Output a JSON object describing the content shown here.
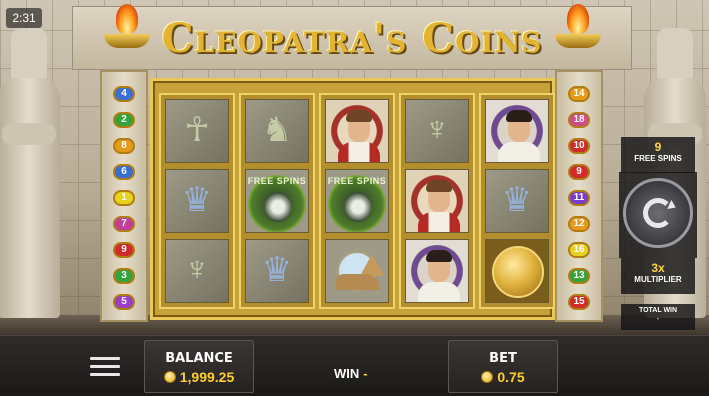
{
  "status": {
    "time": "2:31"
  },
  "game": {
    "title": "Cleopatra's Coins"
  },
  "paylines": {
    "left": [
      "4",
      "2",
      "8",
      "6",
      "1",
      "7",
      "9",
      "3",
      "5"
    ],
    "right": [
      "14",
      "18",
      "10",
      "9",
      "11",
      "12",
      "16",
      "13",
      "15"
    ],
    "left_colors": [
      "#3a6fd1",
      "#34a33c",
      "#e59a1c",
      "#3a6fd1",
      "#e7d21e",
      "#c23d9a",
      "#d02a2a",
      "#34a33c",
      "#9a3ec6"
    ],
    "right_colors": [
      "#e59a1c",
      "#d04a8a",
      "#d02a2a",
      "#d02a2a",
      "#7a3ec6",
      "#e59a1c",
      "#e7d21e",
      "#34a33c",
      "#d02a2a"
    ]
  },
  "reels": [
    [
      {
        "symbol": "ankh-figure"
      },
      {
        "symbol": "seated-pharaoh",
        "tint": "blue"
      },
      {
        "symbol": "goddess-figure"
      }
    ],
    [
      {
        "symbol": "jackal-figure"
      },
      {
        "symbol": "free-spins"
      },
      {
        "symbol": "seated-pharaoh",
        "tint": "blue"
      }
    ],
    [
      {
        "symbol": "roman-man",
        "frame": "red"
      },
      {
        "symbol": "free-spins"
      },
      {
        "symbol": "sphinx"
      }
    ],
    [
      {
        "symbol": "goddess-figure"
      },
      {
        "symbol": "roman-man",
        "frame": "red"
      },
      {
        "symbol": "roman-emperor",
        "frame": "purple"
      }
    ],
    [
      {
        "symbol": "roman-emperor",
        "frame": "purple"
      },
      {
        "symbol": "seated-pharaoh",
        "tint": "blue"
      },
      {
        "symbol": "gold-coin"
      }
    ]
  ],
  "free_spin_symbol": {
    "label": "FREE SPINS"
  },
  "side": {
    "free_spins_count": "9",
    "free_spins_label": "FREE SPINS",
    "multiplier_value": "3x",
    "multiplier_label": "MULTIPLIER",
    "total_win_label": "TOTAL WIN",
    "total_win_value": "-"
  },
  "bottom": {
    "balance_label": "BALANCE",
    "balance_value": "1,999.25",
    "win_label": "WIN",
    "win_value": "-",
    "bet_label": "BET",
    "bet_value": "0.75"
  },
  "colors": {
    "accent_gold": "#ffcf2e",
    "panel_dark": "#1b1918"
  }
}
